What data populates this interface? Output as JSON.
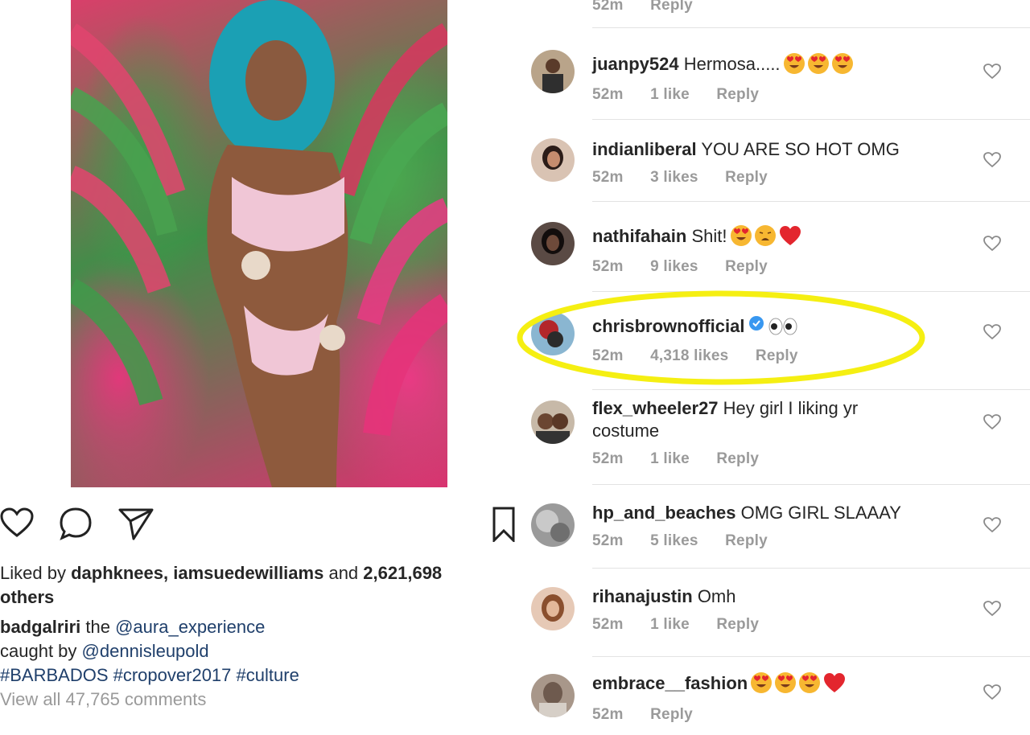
{
  "post": {
    "liked_by_prefix": "Liked by",
    "liked_by_users": "daphknees, iamsuedewilliams",
    "liked_by_and": "and",
    "liked_count": "2,621,698",
    "liked_suffix": "others",
    "caption_user": "badgalriri",
    "caption_line1_text": "the",
    "caption_mention1": "@aura_experience",
    "caption_line2_text": "caught by",
    "caption_mention2": "@dennisleupold",
    "hashtags": [
      "#BARBADOS",
      "#cropover2017",
      "#culture"
    ],
    "view_all_comments": "View all 47,765 comments"
  },
  "top_partial": {
    "time": "52m",
    "reply": "Reply"
  },
  "comments": [
    {
      "username": "juanpy524",
      "text": "Hermosa.....",
      "emoji": [
        "heart-eyes",
        "heart-eyes",
        "heart-eyes"
      ],
      "time": "52m",
      "likes": "1 like",
      "reply": "Reply"
    },
    {
      "username": "indianliberal",
      "text": "YOU ARE SO HOT OMG",
      "emoji": [],
      "time": "52m",
      "likes": "3 likes",
      "reply": "Reply"
    },
    {
      "username": "nathifahain",
      "text": "Shit!",
      "emoji": [
        "heart-eyes",
        "weary-face",
        "red-heart"
      ],
      "time": "52m",
      "likes": "9 likes",
      "reply": "Reply"
    },
    {
      "username": "chrisbrownofficial",
      "text": "",
      "verified": true,
      "emoji": [
        "eyes"
      ],
      "time": "52m",
      "likes": "4,318 likes",
      "reply": "Reply"
    },
    {
      "username": "flex_wheeler27",
      "text": "Hey girl I liking yr costume",
      "emoji": [],
      "time": "52m",
      "likes": "1 like",
      "reply": "Reply"
    },
    {
      "username": "hp_and_beaches",
      "text": "OMG GIRL SLAAAY",
      "emoji": [],
      "time": "52m",
      "likes": "5 likes",
      "reply": "Reply"
    },
    {
      "username": "rihanajustin",
      "text": "Omh",
      "emoji": [],
      "time": "52m",
      "likes": "1 like",
      "reply": "Reply"
    },
    {
      "username": "embrace__fashion",
      "text": "",
      "emoji": [
        "heart-eyes",
        "heart-eyes",
        "heart-eyes",
        "red-heart"
      ],
      "time": "52m",
      "likes": "",
      "reply": "Reply"
    }
  ],
  "colors": {
    "link": "#1f3f6b",
    "muted": "#9a9a9a",
    "highlight": "#f5ef12",
    "verified": "#3897f0"
  }
}
